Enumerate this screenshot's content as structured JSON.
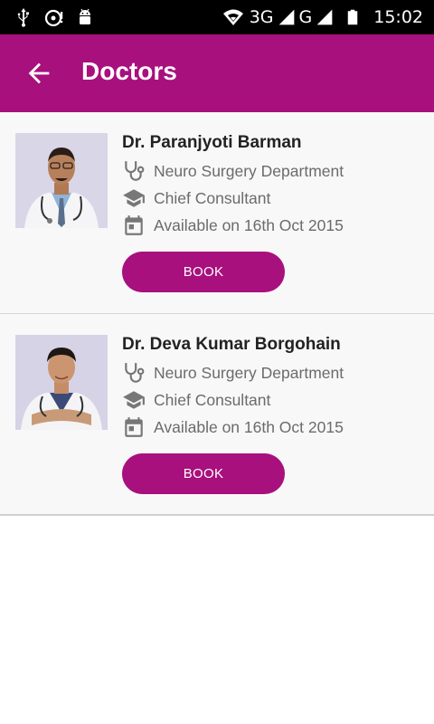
{
  "status_bar": {
    "network_3g": "3G",
    "network_g": "G",
    "time": "15:02",
    "icons": [
      "usb-icon",
      "sync-alert-icon",
      "android-icon",
      "wifi-icon",
      "signal-icon",
      "battery-icon"
    ]
  },
  "app_bar": {
    "title": "Doctors",
    "accent_color": "#a8107d"
  },
  "doctors": [
    {
      "name": "Dr. Paranjyoti Barman",
      "department": "Neuro Surgery Department",
      "designation": "Chief Consultant",
      "availability": "Available on 16th Oct 2015",
      "book_label": "BOOK"
    },
    {
      "name": "Dr. Deva Kumar Borgohain",
      "department": "Neuro Surgery Department",
      "designation": "Chief Consultant",
      "availability": "Available on 16th Oct 2015",
      "book_label": "BOOK"
    }
  ]
}
